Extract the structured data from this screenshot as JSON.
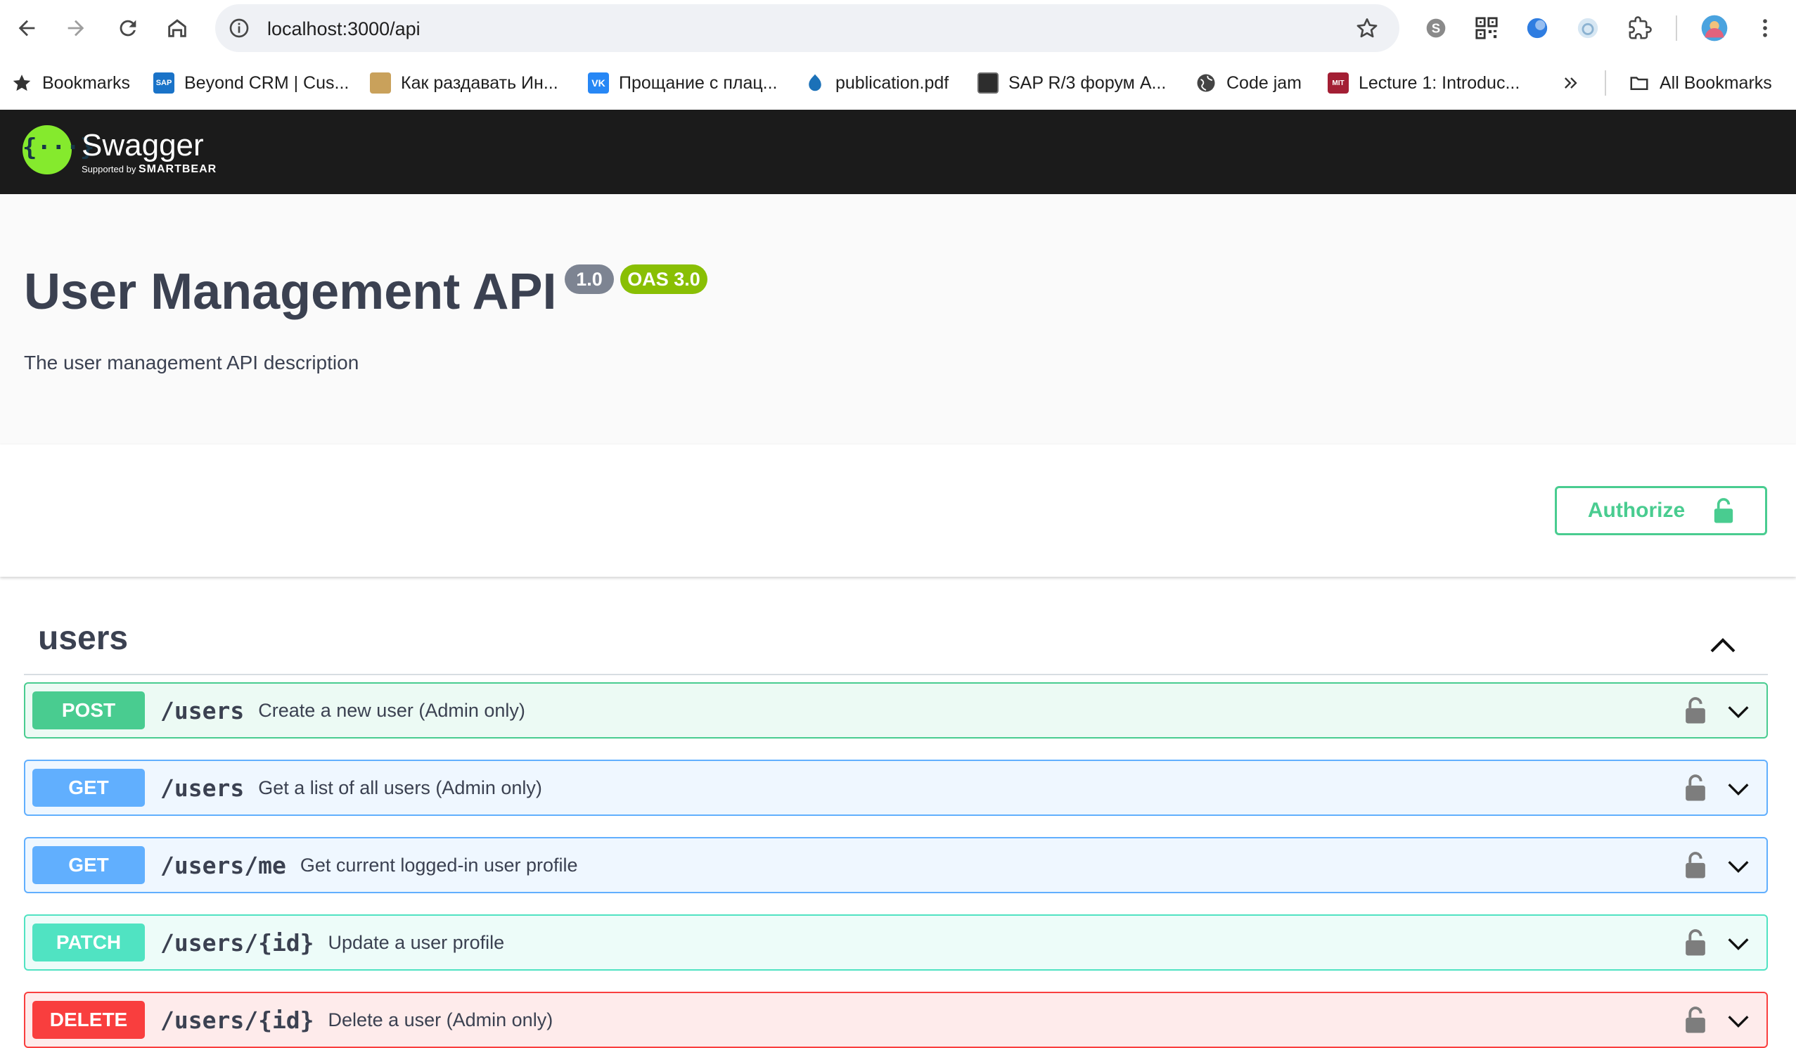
{
  "browser": {
    "url": "localhost:3000/api",
    "bookmarks": [
      {
        "label": "Bookmarks",
        "icon": "star-icon"
      },
      {
        "label": "Beyond CRM | Cus...",
        "icon": "sap-icon"
      },
      {
        "label": "Как раздавать Ин...",
        "icon": "page-icon"
      },
      {
        "label": "Прощание с плац...",
        "icon": "vk-icon"
      },
      {
        "label": "publication.pdf",
        "icon": "drupal-icon"
      },
      {
        "label": "SAP R/3 форум A...",
        "icon": "forum-icon"
      },
      {
        "label": "Code jam",
        "icon": "globe-icon"
      },
      {
        "label": "Lecture 1: Introduc...",
        "icon": "mit-icon"
      }
    ],
    "all_bookmarks": "All Bookmarks"
  },
  "swagger": {
    "logo_name": "Swagger",
    "logo_sub": "Supported by",
    "logo_brand": "SMARTBEAR"
  },
  "info": {
    "title": "User Management API",
    "version": "1.0",
    "oas": "OAS 3.0",
    "description": "The user management API description"
  },
  "authorize_label": "Authorize",
  "tag": {
    "name": "users"
  },
  "operations": [
    {
      "method": "POST",
      "path": "/users",
      "summary": "Create a new user (Admin only)"
    },
    {
      "method": "GET",
      "path": "/users",
      "summary": "Get a list of all users (Admin only)"
    },
    {
      "method": "GET",
      "path": "/users/me",
      "summary": "Get current logged-in user profile"
    },
    {
      "method": "PATCH",
      "path": "/users/{id}",
      "summary": "Update a user profile"
    },
    {
      "method": "DELETE",
      "path": "/users/{id}",
      "summary": "Delete a user (Admin only)"
    }
  ],
  "colors": {
    "post": "#49cc90",
    "get": "#61affe",
    "patch": "#50e3c2",
    "delete": "#f93e3e",
    "topbar": "#1b1b1b"
  }
}
